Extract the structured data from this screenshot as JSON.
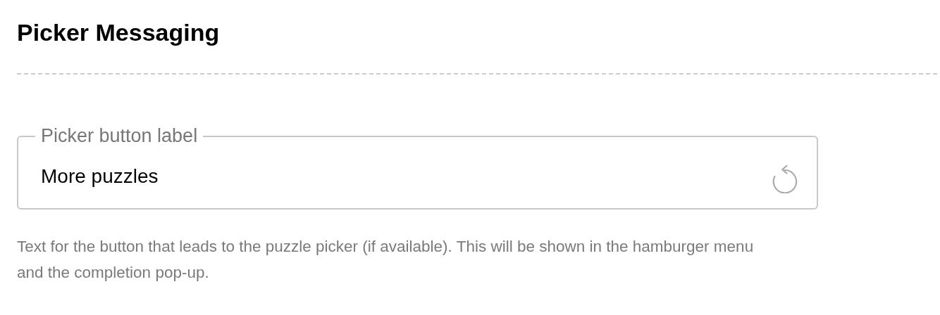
{
  "section": {
    "title": "Picker Messaging"
  },
  "field": {
    "label": "Picker button label",
    "value": "More puzzles",
    "help": "Text for the button that leads to the puzzle picker (if available). This will be shown in the hamburger menu and the completion pop-up."
  }
}
